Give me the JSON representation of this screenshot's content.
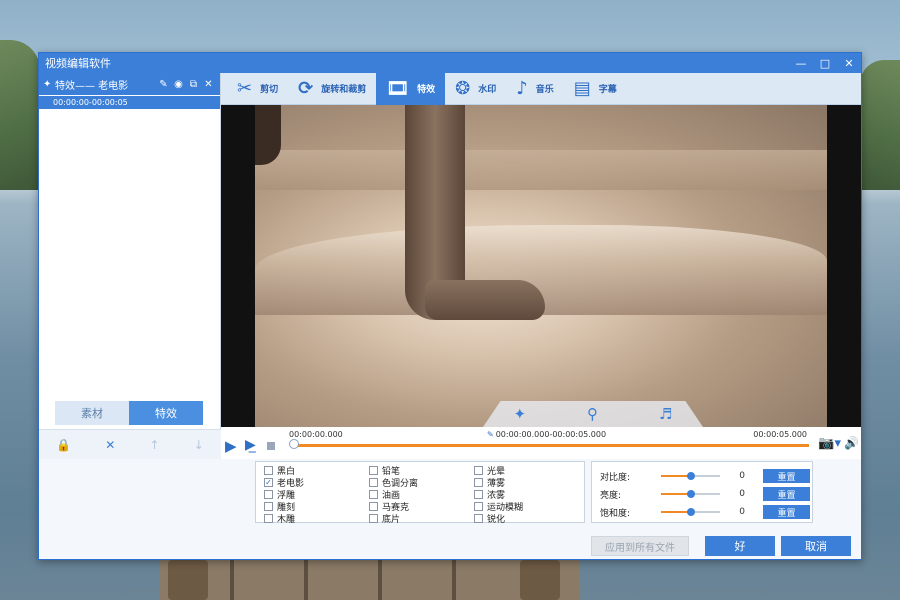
{
  "window": {
    "title": "视频编辑软件",
    "minimize_icon": "minimize-icon",
    "maximize_icon": "maximize-icon",
    "close_icon": "close-icon"
  },
  "left_panel": {
    "effect_item": {
      "label": "特效—— 老电影",
      "time": "00:00:00-00:00:05"
    },
    "tabs": [
      {
        "label": "素材",
        "active": false
      },
      {
        "label": "特效",
        "active": true
      }
    ],
    "actions": [
      "lock-icon",
      "delete-icon",
      "move-up-icon",
      "move-down-icon"
    ]
  },
  "toolbar": {
    "tools": [
      {
        "label": "剪切",
        "icon": "scissors-icon",
        "active": false
      },
      {
        "label": "旋转和裁剪",
        "icon": "crop-rotate-icon",
        "active": false
      },
      {
        "label": "特效",
        "icon": "film-effect-icon",
        "active": true
      },
      {
        "label": "水印",
        "icon": "watermark-icon",
        "active": false
      },
      {
        "label": "音乐",
        "icon": "music-note-icon",
        "active": false
      },
      {
        "label": "字幕",
        "icon": "subtitle-icon",
        "active": false
      }
    ]
  },
  "timeline": {
    "start": "00:00:00.000",
    "range": "00:00:00.000-00:00:05.000",
    "end": "00:00:05.000",
    "progress": 0.0
  },
  "effects": [
    {
      "label": "黑白",
      "checked": false
    },
    {
      "label": "铅笔",
      "checked": false
    },
    {
      "label": "光晕",
      "checked": false
    },
    {
      "label": "老电影",
      "checked": true
    },
    {
      "label": "色调分离",
      "checked": false
    },
    {
      "label": "薄雾",
      "checked": false
    },
    {
      "label": "浮雕",
      "checked": false
    },
    {
      "label": "油画",
      "checked": false
    },
    {
      "label": "浓雾",
      "checked": false
    },
    {
      "label": "雕刻",
      "checked": false
    },
    {
      "label": "马赛克",
      "checked": false
    },
    {
      "label": "运动模糊",
      "checked": false
    },
    {
      "label": "木雕",
      "checked": false
    },
    {
      "label": "底片",
      "checked": false
    },
    {
      "label": "锐化",
      "checked": false
    }
  ],
  "adjustments": [
    {
      "label": "对比度:",
      "value": "0",
      "level": 0.5,
      "reset": "重置"
    },
    {
      "label": "亮度:",
      "value": "0",
      "level": 0.5,
      "reset": "重置"
    },
    {
      "label": "饱和度:",
      "value": "0",
      "level": 0.5,
      "reset": "重置"
    }
  ],
  "buttons": {
    "apply_all": "应用到所有文件",
    "ok": "好",
    "cancel": "取消"
  },
  "colors": {
    "accent": "#3b7fd8",
    "timeline_track": "#f08a24"
  }
}
